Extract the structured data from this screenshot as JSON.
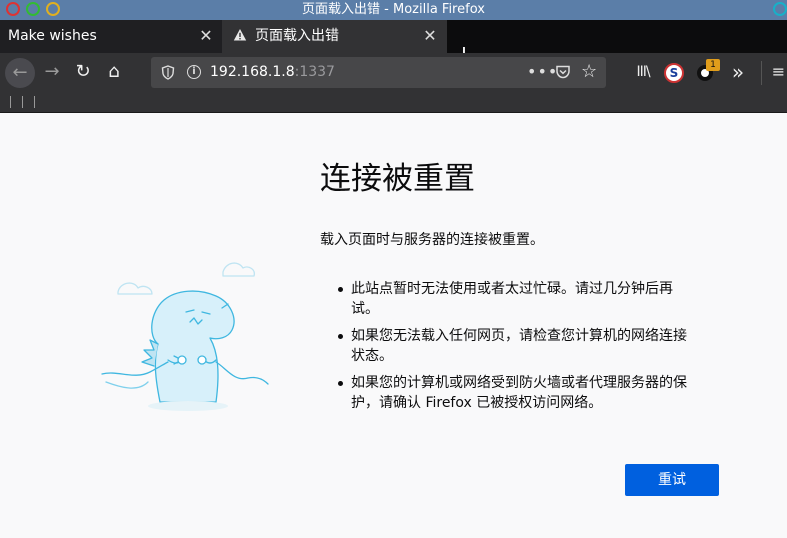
{
  "window": {
    "title": "页面载入出错 - Mozilla Firefox"
  },
  "tabs": [
    {
      "label": "Make wishes",
      "close": "✕"
    },
    {
      "label": "页面载入出错",
      "close": "✕",
      "icon": "warning-icon"
    }
  ],
  "new_tab_label": "+",
  "navbar": {
    "back": "←",
    "forward": "→",
    "reload": "↻",
    "home": "⌂",
    "url_host": "192.168.1.8",
    "url_port": ":1337",
    "more": "•••",
    "star": "☆",
    "library": "III\\",
    "s_extension": "S",
    "ring_badge": "1",
    "overflow": "»",
    "menu": "≡"
  },
  "error": {
    "title": "连接被重置",
    "description": "载入页面时与服务器的连接被重置。",
    "items": [
      {
        "line1": "此站点暂时无法使用或者太过忙碌。请过几分钟后再",
        "line2": "试。"
      },
      {
        "line1": "如果您无法载入任何网页，请检查您计算机的网络连接",
        "line2": "状态。"
      },
      {
        "line1": "如果您的计算机或网络受到防火墙或者代理服务器的保",
        "line2": "护，请确认 Firefox 已被授权访问网络。"
      }
    ],
    "retry_label": "重试"
  },
  "colors": {
    "titlebar": "#5b7ea8",
    "tabstrip": "#0c0c0d",
    "toolbar": "#323234",
    "urlbar": "#474749",
    "content_bg": "#f9f9fa",
    "primary_button": "#0060df",
    "illustration_line": "#3fb7e0"
  }
}
